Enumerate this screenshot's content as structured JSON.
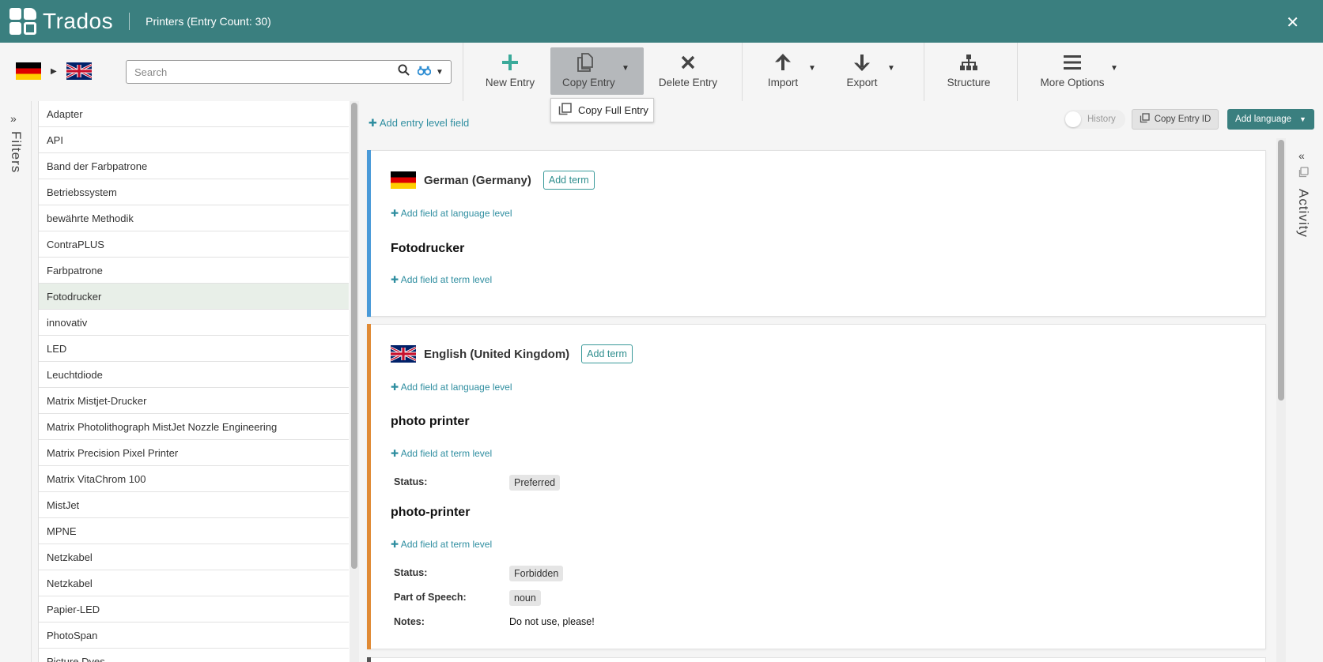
{
  "header": {
    "app_name": "Trados",
    "title": "Printers (Entry Count: 30)"
  },
  "toolbar": {
    "search_placeholder": "Search",
    "new_entry": "New Entry",
    "copy_entry": "Copy Entry",
    "delete_entry": "Delete Entry",
    "import": "Import",
    "export": "Export",
    "structure": "Structure",
    "more_options": "More Options"
  },
  "dropdown": {
    "copy_full_entry": "Copy Full Entry"
  },
  "filters": {
    "label": "Filters"
  },
  "entries": [
    "Adapter",
    "API",
    "Band der Farbpatrone",
    "Betriebssystem",
    "bewährte Methodik",
    "ContraPLUS",
    "Farbpatrone",
    "Fotodrucker",
    "innovativ",
    "LED",
    "Leuchtdiode",
    "Matrix Mistjet-Drucker",
    "Matrix Photolithograph MistJet Nozzle Engineering",
    "Matrix Precision Pixel Printer",
    "Matrix VitaChrom 100",
    "MistJet",
    "MPNE",
    "Netzkabel",
    "Netzkabel",
    "Papier-LED",
    "PhotoSpan",
    "Picture Dyes"
  ],
  "selected_entry": "Fotodrucker",
  "main": {
    "add_entry_field": "Add entry level field",
    "history": "History",
    "copy_entry_id": "Copy Entry ID",
    "add_language": "Add language",
    "add_term": "Add term",
    "add_field_language": "Add field at language level",
    "add_field_term": "Add field at term level",
    "german": {
      "name": "German (Germany)",
      "term": "Fotodrucker"
    },
    "english": {
      "name": "English (United Kingdom)",
      "term1": "photo printer",
      "term1_status_label": "Status:",
      "term1_status": "Preferred",
      "term2": "photo-printer",
      "term2_status_label": "Status:",
      "term2_status": "Forbidden",
      "term2_pos_label": "Part of Speech:",
      "term2_pos": "noun",
      "term2_notes_label": "Notes:",
      "term2_notes": "Do not use, please!"
    }
  },
  "activity": {
    "label": "Activity"
  },
  "colors": {
    "header": "#3a7f7f",
    "link": "#2f8ea0",
    "german_accent": "#4a9ad8",
    "english_accent": "#e08a35"
  }
}
